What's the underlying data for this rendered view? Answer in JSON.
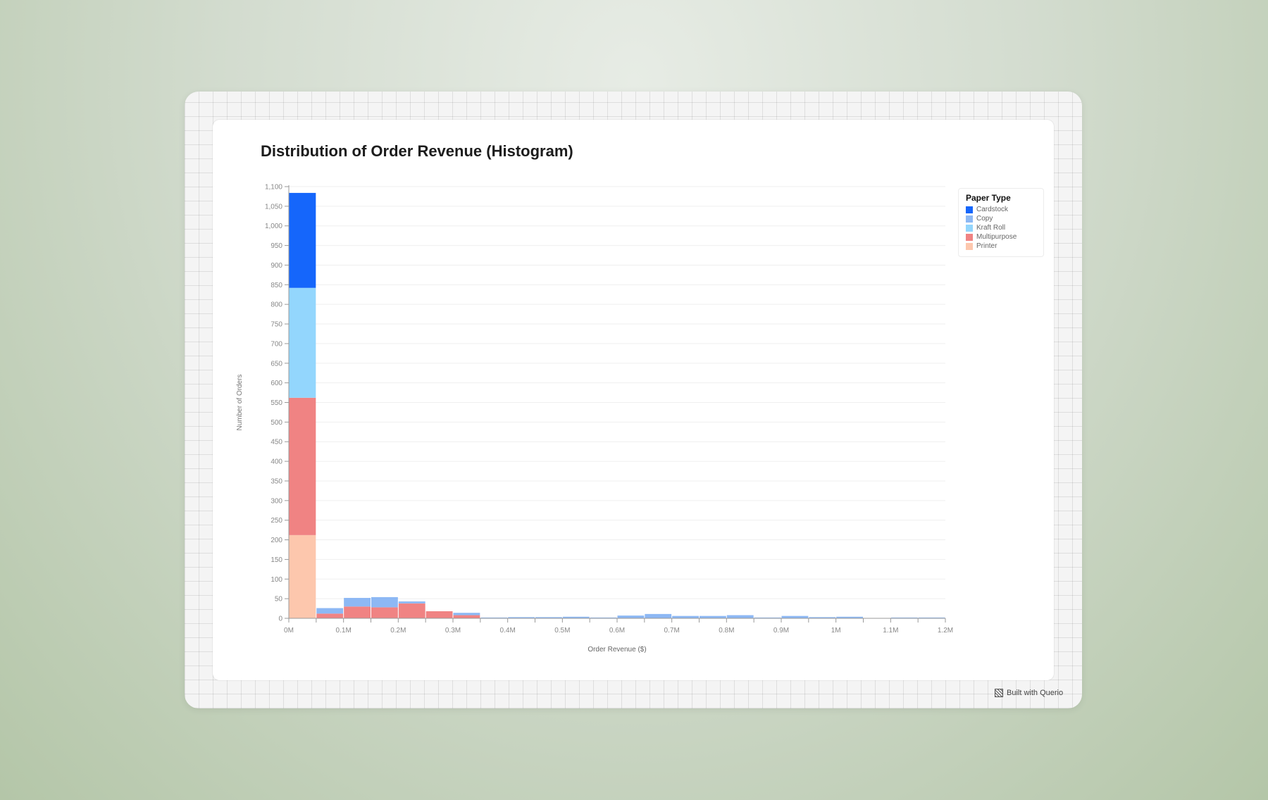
{
  "chart_data": {
    "type": "bar",
    "stacked": true,
    "title": "Distribution of Order Revenue (Histogram)",
    "xlabel": "Order Revenue ($)",
    "ylabel": "Number of Orders",
    "ylim": [
      0,
      1100
    ],
    "yticks": [
      0,
      50,
      100,
      150,
      200,
      250,
      300,
      350,
      400,
      450,
      500,
      550,
      600,
      650,
      700,
      750,
      800,
      850,
      900,
      950,
      1000,
      1050,
      1100
    ],
    "ytick_labels": [
      "0",
      "50",
      "100",
      "150",
      "200",
      "250",
      "300",
      "350",
      "400",
      "450",
      "500",
      "550",
      "600",
      "650",
      "700",
      "750",
      "800",
      "850",
      "900",
      "950",
      "1,000",
      "1,050",
      "1,100"
    ],
    "xlim": [
      0,
      1200000
    ],
    "xticks": [
      0,
      100000,
      200000,
      300000,
      400000,
      500000,
      600000,
      700000,
      800000,
      900000,
      1000000,
      1100000,
      1200000
    ],
    "xtick_labels": [
      "0M",
      "0.1M",
      "0.2M",
      "0.3M",
      "0.4M",
      "0.5M",
      "0.6M",
      "0.7M",
      "0.8M",
      "0.9M",
      "1M",
      "1.1M",
      "1.2M"
    ],
    "bin_width": 50000,
    "bin_starts": [
      0,
      50000,
      100000,
      150000,
      200000,
      250000,
      300000,
      350000,
      400000,
      450000,
      500000,
      550000,
      600000,
      650000,
      700000,
      750000,
      800000,
      850000,
      900000,
      950000,
      1000000,
      1050000,
      1100000,
      1150000
    ],
    "grid": true,
    "legend_title": "Paper Type",
    "legend_position": "top-right",
    "series": [
      {
        "name": "Printer",
        "color": "#fdc7ad",
        "values": [
          212,
          0,
          0,
          0,
          0,
          0,
          0,
          0,
          0,
          0,
          0,
          0,
          0,
          0,
          0,
          0,
          0,
          0,
          0,
          0,
          0,
          0,
          0,
          0
        ]
      },
      {
        "name": "Multipurpose",
        "color": "#f08383",
        "values": [
          350,
          12,
          30,
          28,
          38,
          18,
          8,
          0,
          0,
          0,
          0,
          0,
          0,
          0,
          0,
          0,
          0,
          0,
          0,
          0,
          0,
          0,
          0,
          0
        ]
      },
      {
        "name": "Kraft Roll",
        "color": "#93d6fd",
        "values": [
          280,
          0,
          0,
          0,
          0,
          0,
          0,
          0,
          0,
          0,
          0,
          0,
          0,
          0,
          0,
          0,
          0,
          0,
          0,
          0,
          0,
          0,
          0,
          0
        ]
      },
      {
        "name": "Copy",
        "color": "#8db8f4",
        "values": [
          0,
          14,
          22,
          26,
          5,
          0,
          6,
          2,
          3,
          3,
          4,
          2,
          7,
          11,
          6,
          6,
          8,
          2,
          6,
          3,
          4,
          0,
          2,
          2
        ]
      },
      {
        "name": "Cardstock",
        "color": "#1566fb",
        "values": [
          242,
          0,
          0,
          0,
          0,
          0,
          0,
          0,
          0,
          0,
          0,
          0,
          0,
          0,
          0,
          0,
          0,
          0,
          0,
          0,
          0,
          0,
          0,
          0
        ]
      }
    ],
    "legend_order": [
      "Cardstock",
      "Copy",
      "Kraft Roll",
      "Multipurpose",
      "Printer"
    ]
  },
  "footer": {
    "badge_text": "Built with Querio",
    "badge_icon": "querio-logo-icon"
  }
}
